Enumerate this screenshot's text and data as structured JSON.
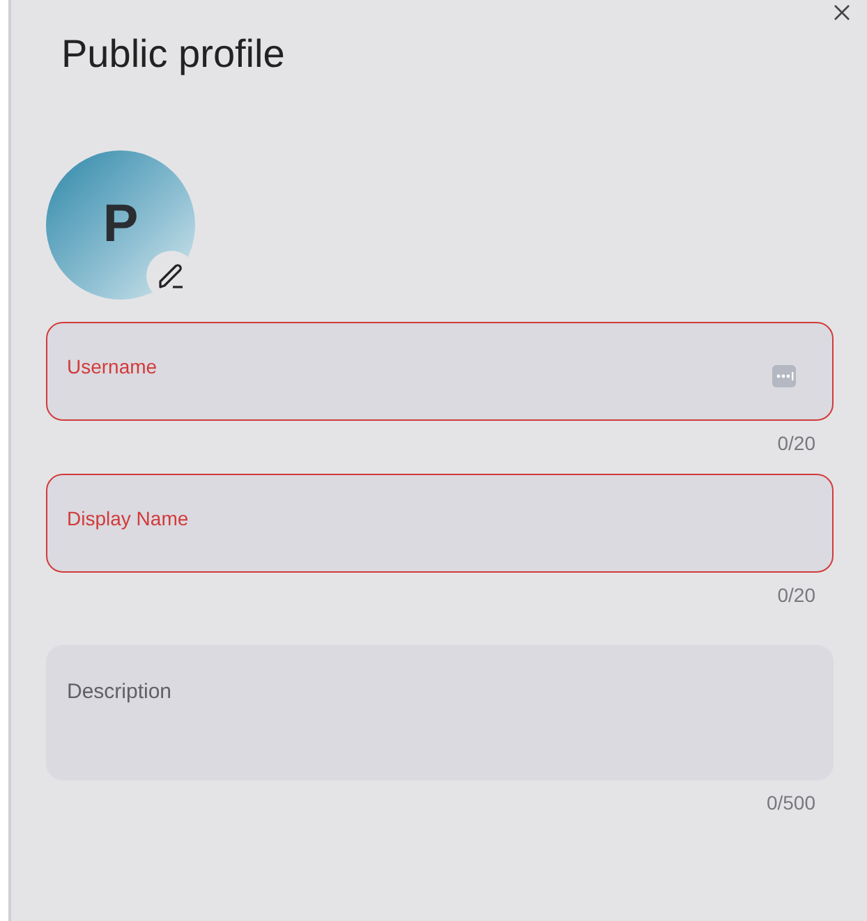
{
  "title": "Public profile",
  "avatar": {
    "initial": "P"
  },
  "fields": [
    {
      "kind": "input",
      "placeholder": "Username",
      "error": true,
      "autofill_icon": true,
      "counter": "0/20"
    },
    {
      "kind": "input",
      "placeholder": "Display Name",
      "error": true,
      "autofill_icon": false,
      "counter": "0/20"
    },
    {
      "kind": "textarea",
      "placeholder": "Description",
      "error": false,
      "autofill_icon": false,
      "counter": "0/500"
    }
  ]
}
